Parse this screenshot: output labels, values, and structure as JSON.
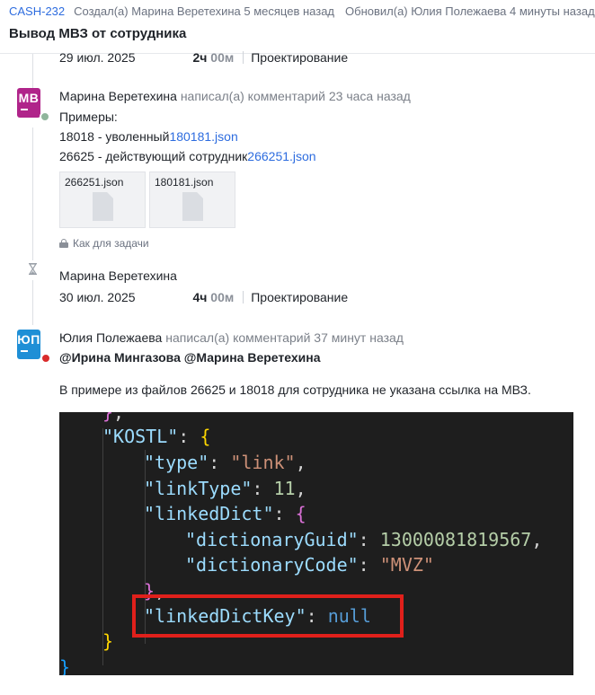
{
  "header": {
    "task_key": "CASH-232",
    "created": "Создал(а) Марина Веретехина 5 месяцев назад",
    "updated": "Обновил(а) Юлия Полежаева 4 минуты назад",
    "title": "Вывод МВЗ от сотрудника"
  },
  "worklog_top": {
    "date": "29 июл. 2025",
    "hours": "2ч",
    "minutes": "00м",
    "activity": "Проектирование"
  },
  "comment1": {
    "avatar_initials": "МВ",
    "author": "Марина Веретехина",
    "action": "написал(а) комментарий 23 часа назад",
    "line1": "Примеры:",
    "line2_text": "18018 - уволенный",
    "line2_link": "180181.json",
    "line3_text": "26625 - действующий сотрудник",
    "line3_link": "266251.json",
    "attachments": [
      "266251.json",
      "180181.json"
    ],
    "visibility": "Как для задачи"
  },
  "worklog2": {
    "author": "Марина Веретехина",
    "date": "30 июл. 2025",
    "hours": "4ч",
    "minutes": "00м",
    "activity": "Проектирование"
  },
  "comment2": {
    "avatar_initials": "ЮП",
    "author": "Юлия Полежаева",
    "action": "написал(а) комментарий 37 минут назад",
    "mentions": "@Ирина Мингазова @Марина Веретехина",
    "body": "В примере из файлов 26625 и 18018 для сотрудника не указана ссылка на МВЗ."
  },
  "code": {
    "kostl_key": "\"KOSTL\"",
    "type_key": "\"type\"",
    "type_value": "\"link\"",
    "linktype_key": "\"linkType\"",
    "linktype_value": "11",
    "linkeddict_key": "\"linkedDict\"",
    "dictguid_key": "\"dictionaryGuid\"",
    "dictguid_value": "13000081819567",
    "dictcode_key": "\"dictionaryCode\"",
    "dictcode_value": "\"MVZ\"",
    "linkeddictkey_key": "\"linkedDictKey\"",
    "linkeddictkey_value": "null"
  },
  "colors": {
    "link": "#2d6cdf",
    "avatar_mv": "#b0248a",
    "avatar_up": "#1e8fd6",
    "highlight": "#e0201b",
    "code_bg": "#1e1e1e"
  }
}
